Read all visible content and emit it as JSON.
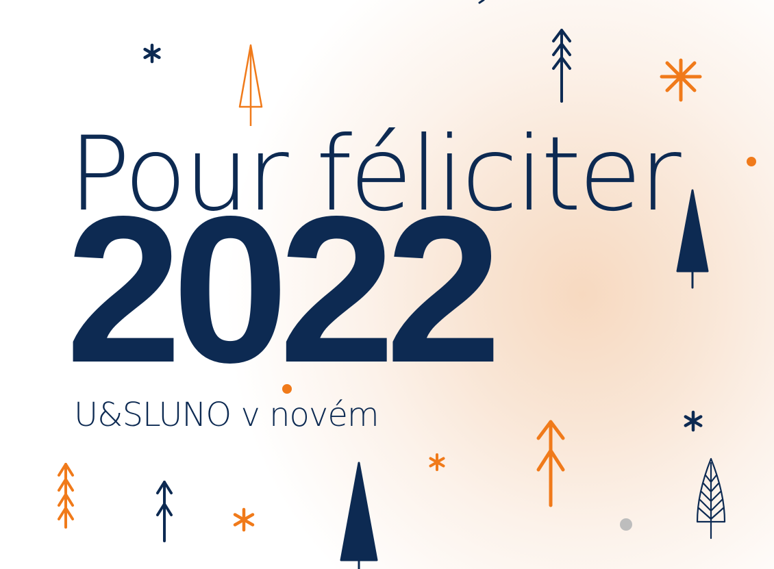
{
  "card": {
    "greeting": "Pour féliciter",
    "year": "2022",
    "tagline": "U&SLUNO v novém"
  },
  "colors": {
    "navy": "#0d2a52",
    "orange": "#f07a1a",
    "grey": "#bdbdbd",
    "glow": "#f7d9c0"
  },
  "decorations": [
    "asterisk-icon",
    "tree-icon",
    "arrow-tree-icon",
    "dot-icon"
  ]
}
